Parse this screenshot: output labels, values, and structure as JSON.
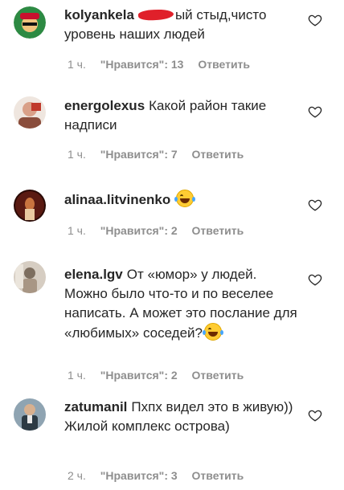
{
  "comments": [
    {
      "username": "kolyankela",
      "text": "ый стыд,чисто уровень наших людей",
      "time": "1 ч.",
      "likes": "\"Нравится\": 13",
      "reply": "Ответить",
      "avatar_colors": [
        "#1f8f3a",
        "#c8102e"
      ]
    },
    {
      "username": "energolexus",
      "text": "Какой район такие надписи",
      "time": "1 ч.",
      "likes": "\"Нравится\": 7",
      "reply": "Ответить",
      "avatar_colors": [
        "#d9a088",
        "#8a4d3c"
      ]
    },
    {
      "username": "alinaa.litvinenko",
      "text": "",
      "emoji": "crying-laughing-emoji",
      "time": "1 ч.",
      "likes": "\"Нравится\": 2",
      "reply": "Ответить",
      "avatar_colors": [
        "#5a1a12",
        "#2a0a06"
      ]
    },
    {
      "username": "elena.lgv",
      "text": "От «юмор» у людей. Можно было что-то и по веселее написать. А может это послание для «любимых» соседей?",
      "emoji": "crying-laughing-emoji",
      "time": "1 ч.",
      "likes": "\"Нравится\": 2",
      "reply": "Ответить",
      "avatar_colors": [
        "#c9b9a6",
        "#7d6e5f"
      ]
    },
    {
      "username": "zatumanil",
      "text": "Пхпх видел это в живую)) Жилой комплекс острова)",
      "time": "2 ч.",
      "likes": "\"Нравится\": 3",
      "reply": "Ответить",
      "avatar_colors": [
        "#6f8a9a",
        "#2c3a44"
      ]
    }
  ]
}
